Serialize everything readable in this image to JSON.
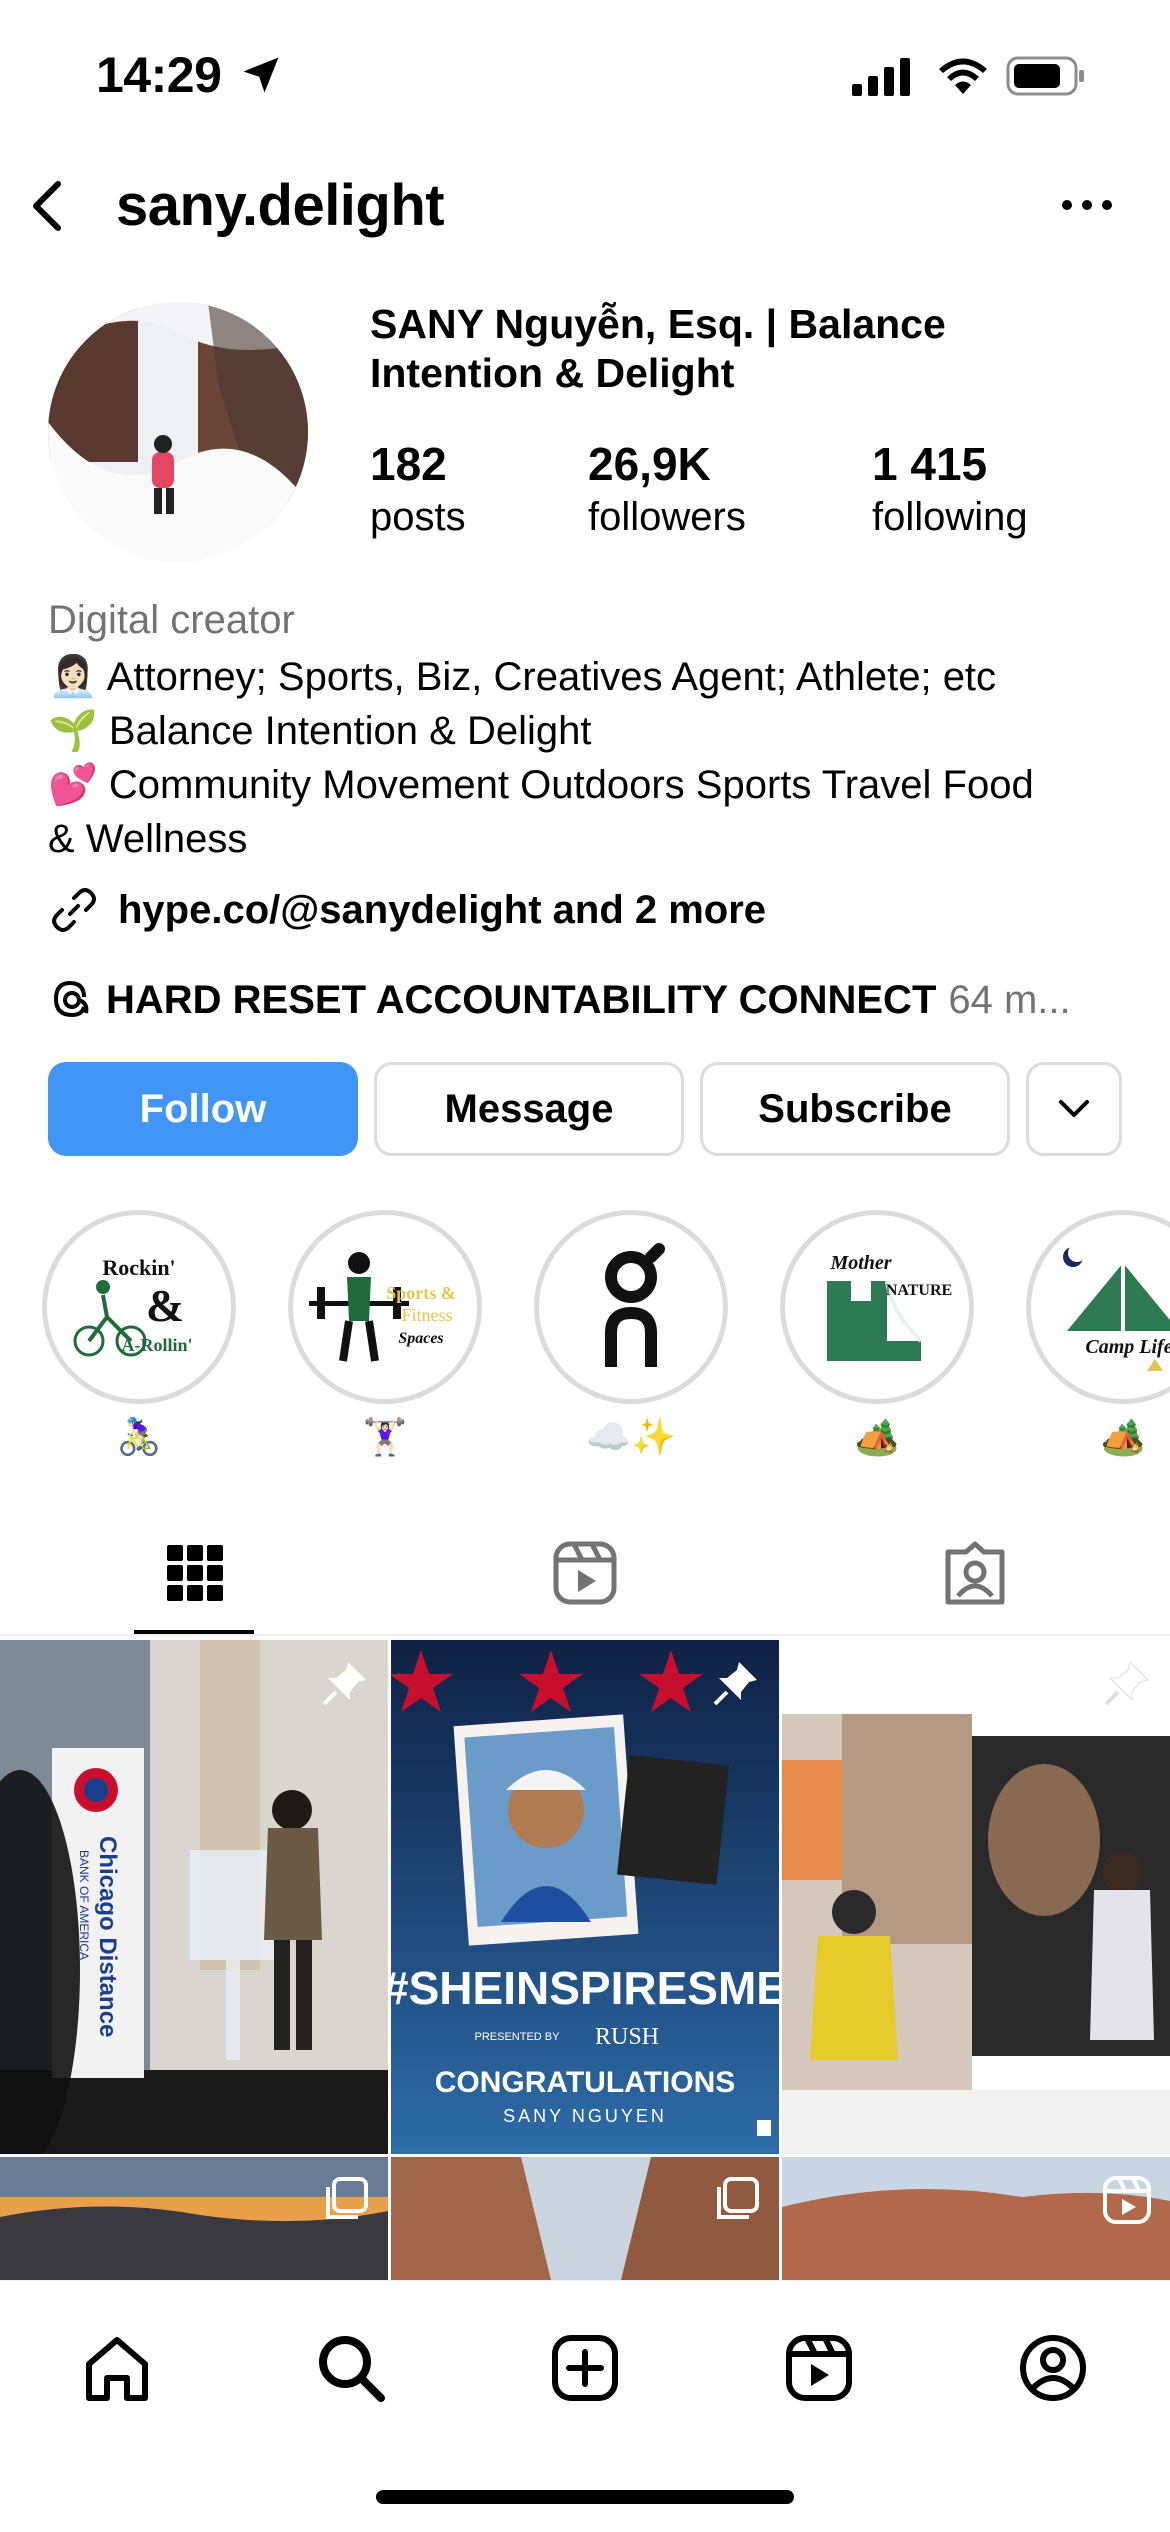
{
  "status_bar": {
    "time": "14:29"
  },
  "header": {
    "username": "sany.delight"
  },
  "profile": {
    "full_name": "SANY Nguyễn, Esq. | Balance Intention & Delight",
    "stats": [
      {
        "value": "182",
        "label": "posts"
      },
      {
        "value": "26,9K",
        "label": "followers"
      },
      {
        "value": "1 415",
        "label": "following"
      }
    ],
    "category": "Digital creator",
    "bio": [
      "👩🏻‍💼 Attorney; Sports, Biz, Creatives Agent; Athlete; etc",
      "🌱 Balance Intention & Delight",
      "💕 Community Movement Outdoors Sports Travel Food",
      "& Wellness"
    ],
    "link": "hype.co/@sanydelight and 2 more",
    "threads_text": "HARD RESET ACCOUNTABILITY CONNECT",
    "threads_count": "64 m..."
  },
  "actions": {
    "follow": "Follow",
    "message": "Message",
    "subscribe": "Subscribe"
  },
  "highlights": [
    {
      "label": "🚴🏻‍♀️",
      "logo_line1": "Rockin'",
      "logo_line2": "&",
      "logo_line3": "A-Rollin'"
    },
    {
      "label": "🏋🏻‍♀️",
      "logo_line1": "Sports &",
      "logo_line2": "Fitness",
      "logo_line3": "Spaces"
    },
    {
      "label": "☁️✨",
      "logo_line1": "",
      "logo_line2": "",
      "logo_line3": ""
    },
    {
      "label": "🏕️",
      "logo_line1": "Mother",
      "logo_line2": "NATURE",
      "logo_line3": ""
    },
    {
      "label": "🏕️",
      "logo_line1": "Camp Life",
      "logo_line2": "",
      "logo_line3": ""
    }
  ],
  "posts": {
    "post2_title": "#SHEINSPIRESME",
    "post2_presented": "PRESENTED BY",
    "post2_sponsor": "RUSH",
    "post2_congrats": "CONGRATULATIONS",
    "post2_name": "SANY NGUYEN",
    "post1_banner": "Chicago Distance",
    "post1_bank": "BANK OF AMERICA"
  },
  "colors": {
    "follow_blue": "#4095f5",
    "border_gray": "#dbdbdb",
    "secondary_text": "#737373"
  }
}
